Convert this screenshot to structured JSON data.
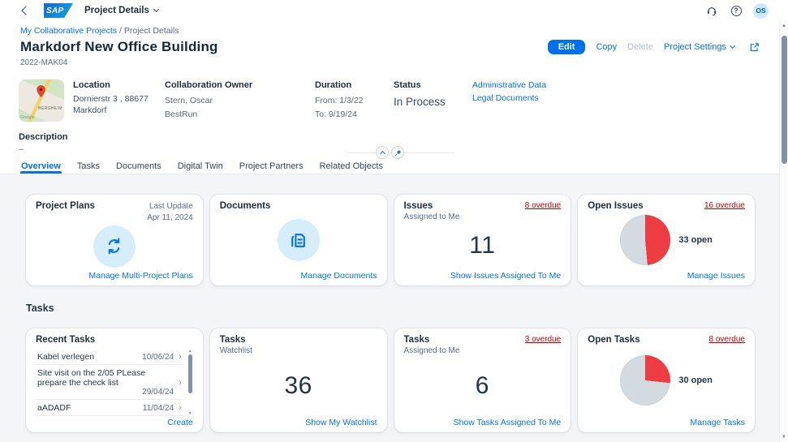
{
  "shell": {
    "app_title": "Project Details",
    "avatar": "OS"
  },
  "icons": {
    "help_glyph": "?",
    "map": [
      "back-icon",
      "sap-logo",
      "chevron-down-icon",
      "headset-icon",
      "help-icon",
      "share-icon",
      "collapse-icon",
      "pin-icon",
      "project-plans-icon",
      "documents-icon",
      "map-pin-icon",
      "chevron-right-icon"
    ]
  },
  "breadcrumb": {
    "parent": "My Collaborative Projects",
    "separator": "/",
    "current": "Project Details"
  },
  "header": {
    "title": "Markdorf New Office Building",
    "subtitle": "2022-MAK04",
    "actions": {
      "edit": "Edit",
      "copy": "Copy",
      "delete": "Delete",
      "project_settings": "Project Settings"
    }
  },
  "info": {
    "location": {
      "label": "Location",
      "value": "Dornierstr 3 , 88677 Markdorf"
    },
    "owner": {
      "label": "Collaboration Owner",
      "name": "Stern, Oscar",
      "company": "BestRun"
    },
    "duration": {
      "label": "Duration",
      "from": "From: 1/3/22",
      "to": "To: 9/19/24"
    },
    "status": {
      "label": "Status",
      "value": "In Process"
    },
    "links": {
      "administrative_data": "Administrative Data",
      "legal_documents": "Legal Documents"
    },
    "description": {
      "label": "Description",
      "value": "–"
    },
    "map": {
      "area_label": "BERGHEIM",
      "watermark": "Google"
    }
  },
  "tabs": {
    "overview": "Overview",
    "tasks": "Tasks",
    "documents": "Documents",
    "digital_twin": "Digital Twin",
    "project_partners": "Project Partners",
    "related_objects": "Related Objects"
  },
  "sections": {
    "tasks_title": "Tasks"
  },
  "cards": {
    "project_plans": {
      "title": "Project Plans",
      "last_update_label": "Last Update",
      "last_update_value": "Apr 11, 2024",
      "footer_link": "Manage Multi-Project Plans"
    },
    "documents": {
      "title": "Documents",
      "footer_link": "Manage Documents"
    },
    "issues_assigned": {
      "title": "Issues",
      "subtitle": "Assigned to Me",
      "overdue_link": "8 overdue",
      "count": "11",
      "footer_link": "Show Issues Assigned To Me"
    },
    "open_issues": {
      "title": "Open Issues",
      "overdue_link": "16 overdue",
      "open_label": "33 open",
      "footer_link": "Manage Issues",
      "pie": {
        "value": 16,
        "total": 33,
        "color": "#ee3d42",
        "rest_color": "#d3dae0"
      }
    },
    "recent_tasks": {
      "title": "Recent Tasks",
      "footer_link": "Create",
      "items": [
        {
          "name": "Kabel verlegen",
          "date": "10/06/24"
        },
        {
          "name": "Site visit on the 2/05 PLease prepare the check list",
          "date": "29/04/24"
        },
        {
          "name": "aADADF",
          "date": "11/04/24"
        }
      ]
    },
    "tasks_watchlist": {
      "title": "Tasks",
      "subtitle": "Watchlist",
      "count": "36",
      "footer_link": "Show My Watchlist"
    },
    "tasks_assigned": {
      "title": "Tasks",
      "subtitle": "Assigned to Me",
      "overdue_link": "3 overdue",
      "count": "6",
      "footer_link": "Show Tasks Assigned To Me"
    },
    "open_tasks": {
      "title": "Open Tasks",
      "overdue_link": "8 overdue",
      "open_label": "30 open",
      "footer_link": "Manage Tasks",
      "pie": {
        "value": 8,
        "total": 30,
        "color": "#ee3d42",
        "rest_color": "#d3dae0"
      }
    }
  },
  "chart_data": [
    {
      "type": "pie",
      "title": "Open Issues",
      "categories": [
        "overdue",
        "other open"
      ],
      "values": [
        16,
        17
      ],
      "total_label": "33 open"
    },
    {
      "type": "pie",
      "title": "Open Tasks",
      "categories": [
        "overdue",
        "other open"
      ],
      "values": [
        8,
        22
      ],
      "total_label": "30 open"
    }
  ],
  "colors": {
    "accent": "#0070f2",
    "negative": "#c00000",
    "pie_filled": "#ee3d42",
    "pie_rest": "#d3dae0",
    "content_bg": "#f4f5f7"
  }
}
